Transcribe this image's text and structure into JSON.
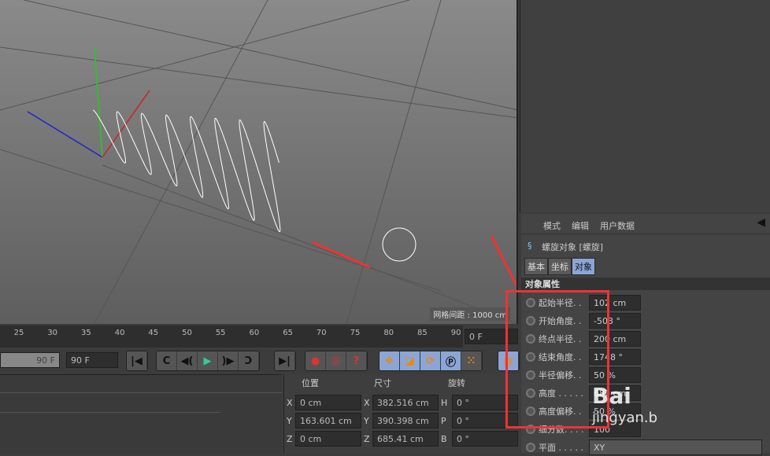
{
  "viewport": {
    "grid_spacing_label": "网格间距 : 1000 cm"
  },
  "timeline": {
    "ticks": [
      "25",
      "30",
      "35",
      "40",
      "45",
      "50",
      "55",
      "60",
      "65",
      "70",
      "75",
      "80",
      "85",
      "90"
    ],
    "current_frame": "0 F",
    "end_frame_slider": "90 F",
    "end_frame_field": "90 F"
  },
  "transport": {
    "buttons": [
      "go-to-start",
      "previous-key",
      "previous-frame",
      "play",
      "next-frame",
      "next-key",
      "go-to-end"
    ],
    "record": [
      "record",
      "auto-key",
      "help"
    ],
    "modes": [
      "move",
      "scale",
      "rotate",
      "parameter",
      "points"
    ]
  },
  "coordinates": {
    "headers": {
      "position": "位置",
      "size": "尺寸",
      "rotation": "旋转"
    },
    "rows": [
      {
        "axis": "X",
        "pos": "0 cm",
        "saxis": "X",
        "size": "382.516 cm",
        "raxis": "H",
        "rot": "0 °"
      },
      {
        "axis": "Y",
        "pos": "163.601 cm",
        "saxis": "Y",
        "size": "390.398 cm",
        "raxis": "P",
        "rot": "0 °"
      },
      {
        "axis": "Z",
        "pos": "0 cm",
        "saxis": "Z",
        "size": "685.41 cm",
        "raxis": "B",
        "rot": "0 °"
      }
    ]
  },
  "attributes": {
    "menu": [
      "模式",
      "编辑",
      "用户数据"
    ],
    "object_title": "螺旋对象 [螺旋]",
    "tabs": [
      "基本",
      "坐标",
      "对象"
    ],
    "active_tab": "对象",
    "section": "对象属性",
    "params": [
      {
        "label": "起始半径. .",
        "value": "102 cm"
      },
      {
        "label": "开始角度. .",
        "value": "-503 °"
      },
      {
        "label": "终点半径. .",
        "value": "200 cm"
      },
      {
        "label": "结束角度. .",
        "value": "1748 °"
      },
      {
        "label": "半径偏移. .",
        "value": "50 %"
      },
      {
        "label": "高度 . . . . .",
        "value": "682 cm"
      },
      {
        "label": "高度偏移. .",
        "value": "50 %"
      },
      {
        "label": "细分数. . . .",
        "value": "100"
      },
      {
        "label": "平面 . . . . .",
        "value": "XY"
      }
    ]
  },
  "watermark": {
    "logo": "Bai",
    "text": "jingyan.b"
  },
  "colors": {
    "accent": "#8ba6d6",
    "highlight": "#ee3333"
  }
}
